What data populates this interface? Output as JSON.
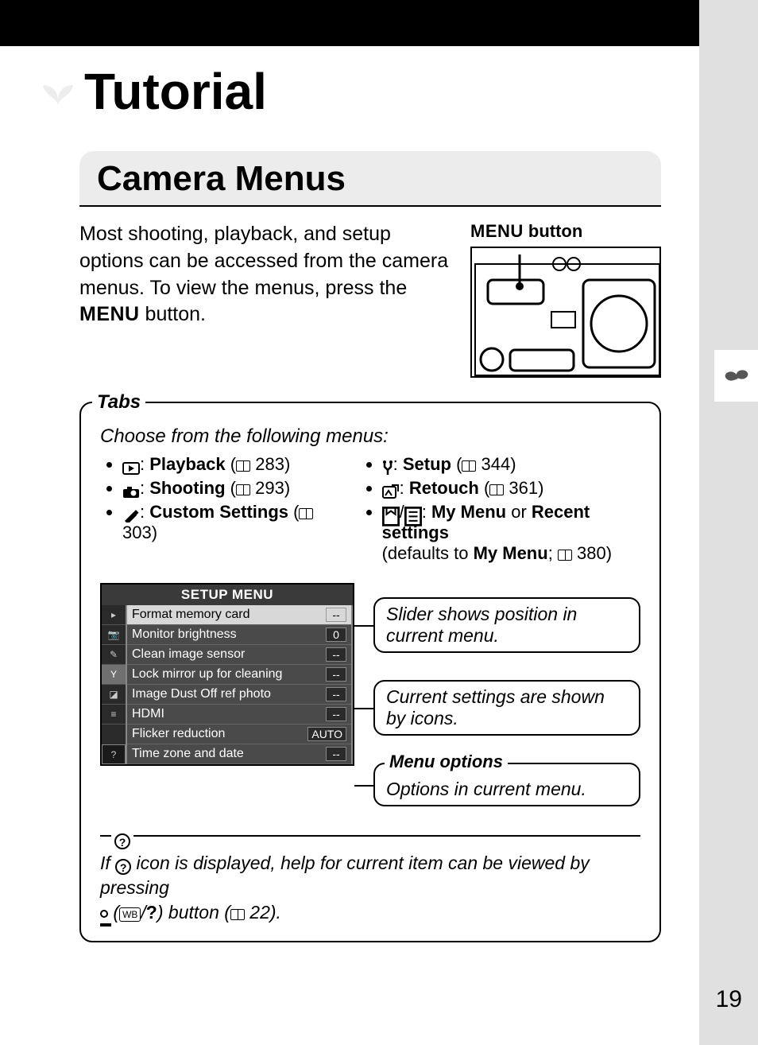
{
  "page_number": "19",
  "title": "Tutorial",
  "section_heading": "Camera Menus",
  "intro_pre": "Most shooting, playback, and setup options can be accessed from the camera menus.  To view the menus, press the ",
  "intro_menu": "MENU",
  "intro_post": " button.",
  "menu_button_caption_pre": "MENU",
  "menu_button_caption_post": " button",
  "tabs_label": "Tabs",
  "tabs_subtitle": "Choose from the following menus:",
  "menus_left": [
    {
      "name": "Playback",
      "page": "283"
    },
    {
      "name": "Shooting",
      "page": "293"
    },
    {
      "name": "Custom Settings",
      "page": "303"
    }
  ],
  "menus_right": [
    {
      "name": "Setup",
      "page": "344"
    },
    {
      "name": "Retouch",
      "page": "361"
    }
  ],
  "mymenu_label": "My Menu",
  "mymenu_or": " or ",
  "mymenu_recent": "Recent settings",
  "mymenu_defaults_pre": "(defaults to ",
  "mymenu_defaults_bold": "My Menu",
  "mymenu_page": "380",
  "screen_title": "SETUP MENU",
  "screen_rows": [
    {
      "label": "Format memory card",
      "value": "--",
      "selected": true
    },
    {
      "label": "Monitor brightness",
      "value": "0"
    },
    {
      "label": "Clean image sensor",
      "value": "--"
    },
    {
      "label": "Lock mirror up for cleaning",
      "value": "--"
    },
    {
      "label": "Image Dust Off ref photo",
      "value": "--"
    },
    {
      "label": "HDMI",
      "value": "--"
    },
    {
      "label": "Flicker reduction",
      "value": "AUTO"
    },
    {
      "label": "Time zone and date",
      "value": "--"
    }
  ],
  "callout_slider": "Slider shows position in current menu.",
  "callout_icons": "Current settings are shown by icons.",
  "menu_options_label": "Menu options",
  "callout_options": "Options in current menu.",
  "help_text_1": "If ",
  "help_text_2": " icon is displayed, help for current item can be viewed by pressing ",
  "help_text_3": " (",
  "help_text_4": "/",
  "help_text_5": ") button (",
  "help_text_6": " 22).",
  "qmark": "?",
  "wb_label": "WB"
}
